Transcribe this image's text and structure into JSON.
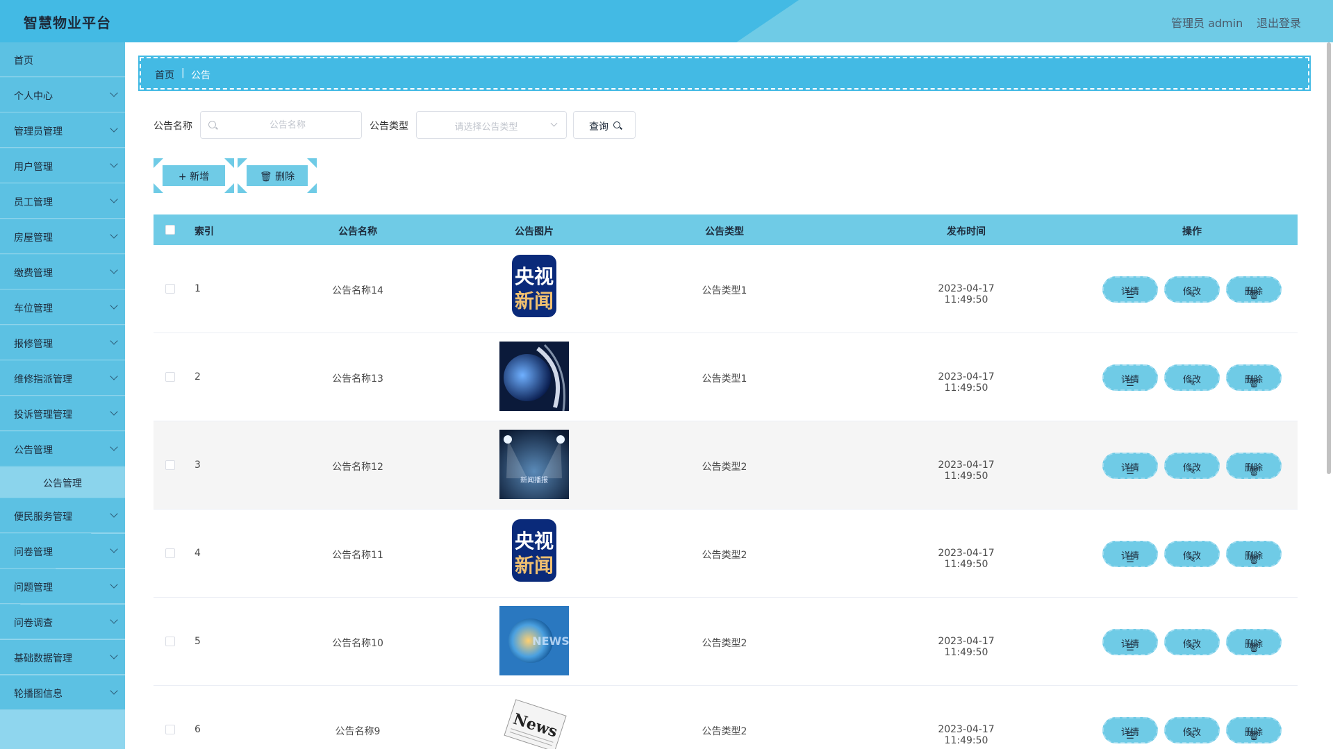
{
  "header": {
    "title": "智慧物业平台",
    "user": "管理员 admin",
    "logout": "退出登录"
  },
  "sidebar": {
    "items": [
      {
        "label": "首页",
        "chevron": false
      },
      {
        "label": "个人中心",
        "chevron": true
      },
      {
        "label": "管理员管理",
        "chevron": true
      },
      {
        "label": "用户管理",
        "chevron": true
      },
      {
        "label": "员工管理",
        "chevron": true
      },
      {
        "label": "房屋管理",
        "chevron": true
      },
      {
        "label": "缴费管理",
        "chevron": true
      },
      {
        "label": "车位管理",
        "chevron": true
      },
      {
        "label": "报修管理",
        "chevron": true
      },
      {
        "label": "维修指派管理",
        "chevron": true
      },
      {
        "label": "投诉管理管理",
        "chevron": true
      },
      {
        "label": "公告管理",
        "chevron": true
      },
      {
        "label": "便民服务管理",
        "chevron": true
      },
      {
        "label": "问卷管理",
        "chevron": true
      },
      {
        "label": "问题管理",
        "chevron": true
      },
      {
        "label": "问卷调查",
        "chevron": true
      },
      {
        "label": "基础数据管理",
        "chevron": true
      },
      {
        "label": "轮播图信息",
        "chevron": true
      }
    ],
    "subitem": "公告管理"
  },
  "breadcrumb": {
    "home": "首页",
    "sep": "|",
    "current": "公告"
  },
  "search": {
    "name_label": "公告名称",
    "name_placeholder": "公告名称",
    "type_label": "公告类型",
    "type_placeholder": "请选择公告类型",
    "query": "查询"
  },
  "actions": {
    "add": "新增",
    "delete": "删除"
  },
  "table": {
    "headers": {
      "index": "索引",
      "name": "公告名称",
      "image": "公告图片",
      "type": "公告类型",
      "time": "发布时间",
      "ops": "操作"
    },
    "op_labels": {
      "detail": "详情",
      "edit": "修改",
      "delete": "删除"
    },
    "rows": [
      {
        "index": "1",
        "name": "公告名称14",
        "image": "cctv-news-logo",
        "type": "公告类型1",
        "time": "2023-04-17 11:49:50"
      },
      {
        "index": "2",
        "name": "公告名称13",
        "image": "globe-news-photo",
        "type": "公告类型1",
        "time": "2023-04-17 11:49:50"
      },
      {
        "index": "3",
        "name": "公告名称12",
        "image": "spotlight-stage-photo",
        "type": "公告类型2",
        "time": "2023-04-17 11:49:50"
      },
      {
        "index": "4",
        "name": "公告名称11",
        "image": "cctv-news-logo",
        "type": "公告类型2",
        "time": "2023-04-17 11:49:50"
      },
      {
        "index": "5",
        "name": "公告名称10",
        "image": "news-globe-photo",
        "type": "公告类型2",
        "time": "2023-04-17 11:49:50"
      },
      {
        "index": "6",
        "name": "公告名称9",
        "image": "newspaper-photo",
        "type": "公告类型2",
        "time": "2023-04-17 11:49:50"
      }
    ]
  },
  "image_text": {
    "logo_line1": "央视",
    "logo_line2": "新闻",
    "stage_caption": "新闻播报",
    "news_overlay": "NEWS",
    "newspaper_word": "News"
  },
  "colors": {
    "header": "#43bae4",
    "accent": "#6fcbe6",
    "sidebar": "#5cc1e3"
  }
}
